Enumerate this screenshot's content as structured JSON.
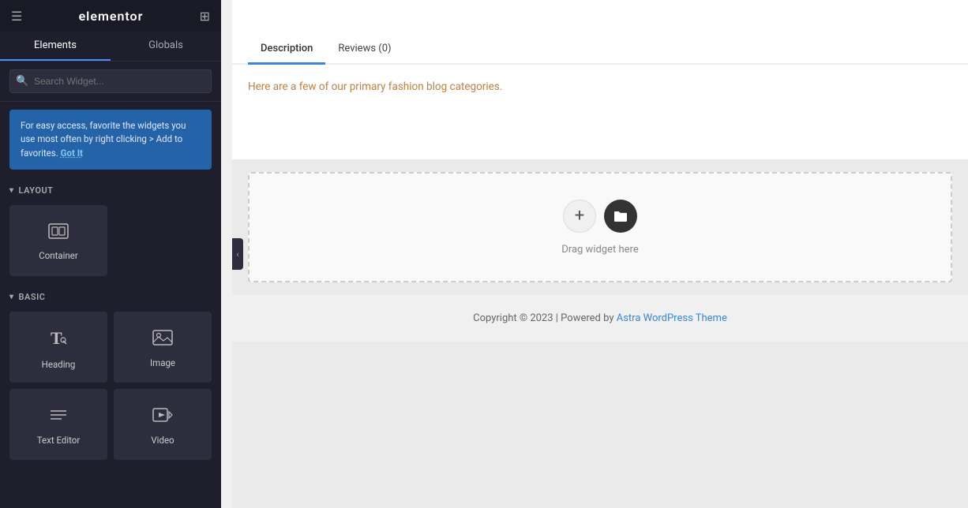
{
  "sidebar": {
    "title": "elementor",
    "tabs": [
      {
        "label": "Elements",
        "active": true
      },
      {
        "label": "Globals",
        "active": false
      }
    ],
    "search": {
      "placeholder": "Search Widget..."
    },
    "tip": {
      "text": "For easy access, favorite the widgets you use most often by right clicking > Add to favorites.",
      "cta": "Got It"
    },
    "sections": [
      {
        "label": "Layout",
        "widgets": [
          {
            "icon": "container-icon",
            "label": "Container"
          }
        ]
      },
      {
        "label": "Basic",
        "widgets": [
          {
            "icon": "heading-icon",
            "label": "Heading"
          },
          {
            "icon": "image-icon",
            "label": "Image"
          },
          {
            "icon": "text-editor-icon",
            "label": "Text Editor"
          },
          {
            "icon": "video-icon",
            "label": "Video"
          }
        ]
      }
    ]
  },
  "canvas": {
    "tabs": [
      {
        "label": "Description",
        "active": true
      },
      {
        "label": "Reviews (0)",
        "active": false
      }
    ],
    "description_text": "Here are a few of our primary fashion blog categories.",
    "drag_label": "Drag widget here",
    "footer_text": "Copyright © 2023 | Powered by ",
    "footer_link_text": "Astra WordPress Theme",
    "footer_link_url": "#"
  },
  "icons": {
    "hamburger": "☰",
    "grid": "⊞",
    "search": "🔍",
    "container": "⬚",
    "heading": "T",
    "image": "🖼",
    "text_editor": "≡",
    "video": "▷",
    "plus": "+",
    "folder": "🗂",
    "chevron_left": "‹",
    "chevron_down": "▾"
  }
}
